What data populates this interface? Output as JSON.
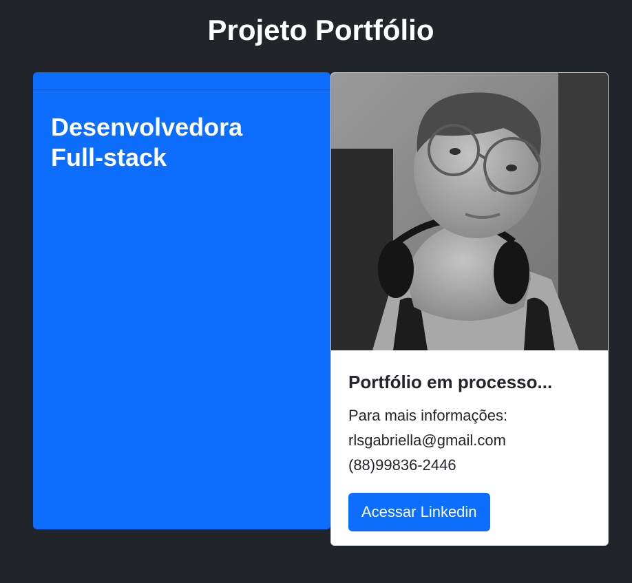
{
  "header": {
    "title": "Projeto Portfólio"
  },
  "left_card": {
    "title_line1": "Desenvolvedora",
    "title_line2": "Full-stack"
  },
  "right_card": {
    "photo_icon": "profile-photo",
    "title": "Portfólio em processo...",
    "info_label": "Para mais informações:",
    "email": "rlsgabriella@gmail.com",
    "phone": "(88)99836-2446",
    "button_label": "Acessar Linkedin"
  },
  "colors": {
    "background": "#212529",
    "accent": "#0d6efd",
    "card": "#ffffff",
    "text_dark": "#212529"
  }
}
